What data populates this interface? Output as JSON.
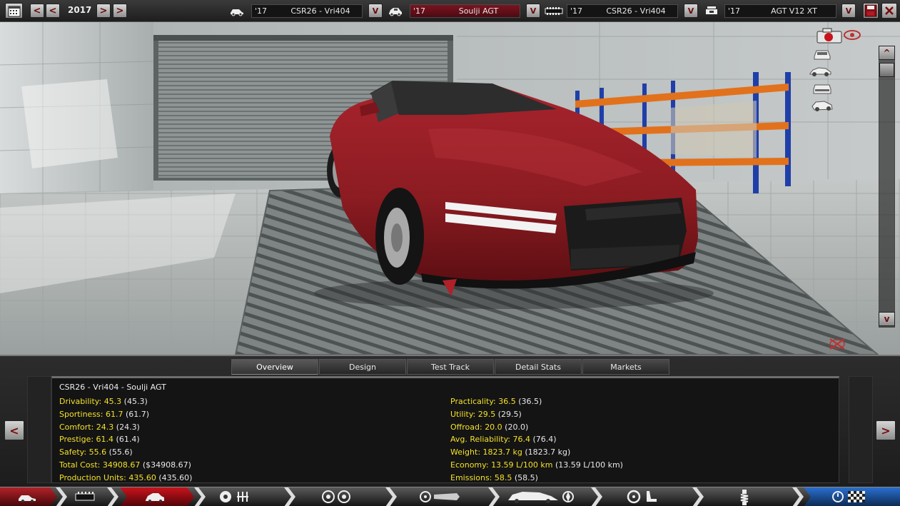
{
  "toolbar": {
    "year": "2017",
    "prev_year_fast": "<",
    "prev_year": "<",
    "next_year": ">",
    "next_year_fast": ">",
    "selectors": [
      {
        "icon": "chassis-icon",
        "year": "'17",
        "name": "CSR26 - Vri404",
        "highlight": false
      },
      {
        "icon": "car-model-icon",
        "year": "'17",
        "name": "Soulji AGT",
        "highlight": true
      },
      {
        "icon": "engine-block-icon",
        "year": "'17",
        "name": "CSR26 - Vri404",
        "highlight": false
      },
      {
        "icon": "engine-variant-icon",
        "year": "'17",
        "name": "AGT V12 XT",
        "highlight": false
      }
    ],
    "dropdown_glyph": "V",
    "save_icon": "save-icon",
    "close_icon": "close-icon"
  },
  "viewport": {
    "scroll_up": "^",
    "scroll_down": "v",
    "view_icons": [
      "camera-icon",
      "front-view-icon",
      "side-view-icon",
      "rear-view-icon",
      "three-quarter-view-icon",
      "visibility-icon",
      "reset-view-icon"
    ],
    "car_color": "#8c1c22"
  },
  "panel": {
    "tabs": [
      {
        "label": "Overview",
        "active": true
      },
      {
        "label": "Design",
        "active": false
      },
      {
        "label": "Test Track",
        "active": false
      },
      {
        "label": "Detail Stats",
        "active": false
      },
      {
        "label": "Markets",
        "active": false
      }
    ],
    "title": "CSR26 - Vri404 - Soulji AGT",
    "left_stats": [
      {
        "key": "Drivability: ",
        "value": "45.3",
        "paren": " (45.3)"
      },
      {
        "key": "Sportiness: ",
        "value": "61.7",
        "paren": " (61.7)"
      },
      {
        "key": "Comfort: ",
        "value": "24.3",
        "paren": " (24.3)"
      },
      {
        "key": "Prestige: ",
        "value": "61.4",
        "paren": " (61.4)"
      },
      {
        "key": "Safety: ",
        "value": "55.6",
        "paren": " (55.6)"
      },
      {
        "key": "Total Cost: ",
        "value": "34908.67",
        "paren": " ($34908.67)"
      },
      {
        "key": "Production Units: ",
        "value": "435.60",
        "paren": " (435.60)"
      }
    ],
    "right_stats": [
      {
        "key": "Practicality: ",
        "value": "36.5",
        "paren": " (36.5)"
      },
      {
        "key": "Utility: ",
        "value": "29.5",
        "paren": " (29.5)"
      },
      {
        "key": "Offroad: ",
        "value": "20.0",
        "paren": " (20.0)"
      },
      {
        "key": "Avg. Reliability: ",
        "value": "76.4",
        "paren": " (76.4)"
      },
      {
        "key": "Weight: ",
        "value": "1823.7 kg",
        "paren": " (1823.7 kg)"
      },
      {
        "key": "Economy: ",
        "value": "13.59 L/100 km",
        "paren": " (13.59 L/100 km)"
      },
      {
        "key": "Emissions: ",
        "value": "58.5",
        "paren": " (58.5)"
      }
    ],
    "prev_arrow": "<",
    "next_arrow": ">"
  },
  "stepbar": {
    "steps": [
      "chassis-step-icon",
      "body-step-icon",
      "model-step-icon",
      "engine-step-icon",
      "wheels-step-icon",
      "fixtures-step-icon",
      "aero-step-icon",
      "interior-step-icon",
      "suspension-step-icon",
      "finish-step-icon"
    ],
    "active_step": 2
  }
}
